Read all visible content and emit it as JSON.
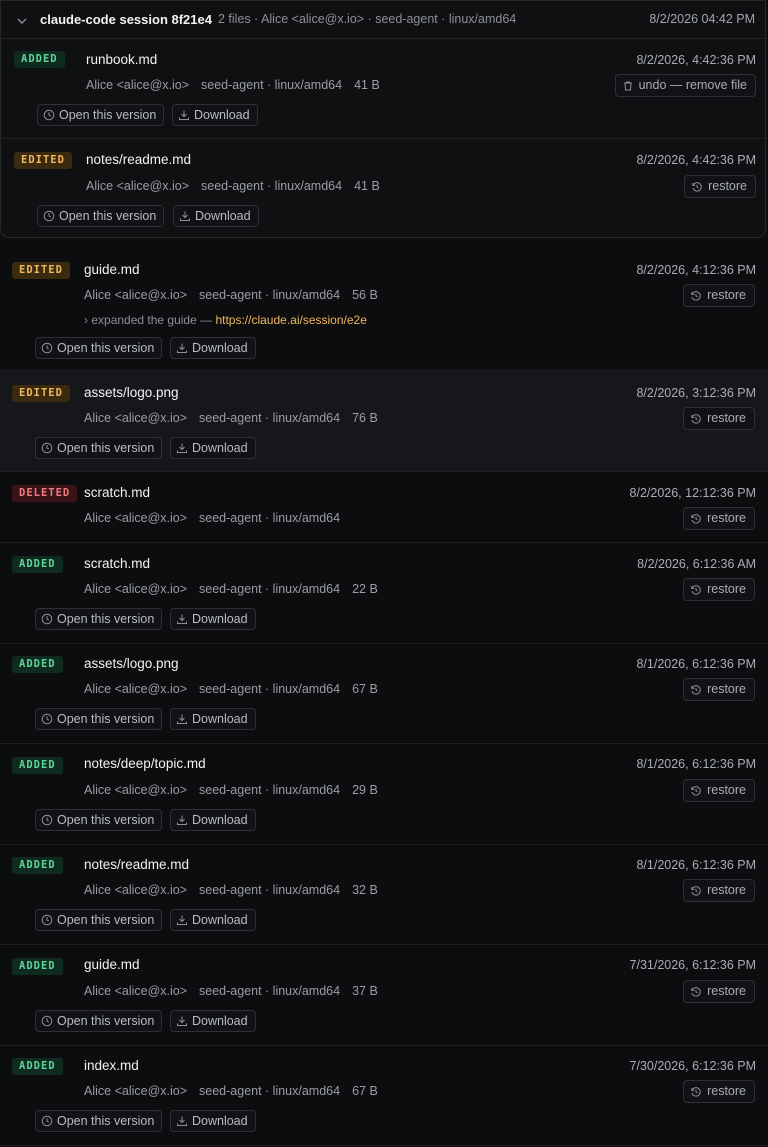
{
  "session": {
    "title": "claude-code session 8f21e4",
    "meta": "2 files · Alice <alice@x.io> · seed-agent · linux/amd64",
    "date": "8/2/2026 04:42 PM"
  },
  "labels": {
    "open": "Open this version",
    "download": "Download",
    "restore": "restore",
    "undo": "undo — remove file",
    "author": "Alice <alice@x.io>",
    "agent": "seed-agent · linux/amd64"
  },
  "rows": [
    {
      "badge": "ADDED",
      "file": "runbook.md",
      "date": "8/2/2026, 4:42:36 PM",
      "size": "41 B"
    },
    {
      "badge": "EDITED",
      "file": "notes/readme.md",
      "date": "8/2/2026, 4:42:36 PM",
      "size": "41 B"
    },
    {
      "badge": "EDITED",
      "file": "guide.md",
      "date": "8/2/2026, 4:12:36 PM",
      "size": "56 B",
      "note": "expanded the guide —",
      "link": "https://claude.ai/session/e2e"
    },
    {
      "badge": "EDITED",
      "file": "assets/logo.png",
      "date": "8/2/2026, 3:12:36 PM",
      "size": "76 B"
    },
    {
      "badge": "DELETED",
      "file": "scratch.md",
      "date": "8/2/2026, 12:12:36 PM",
      "size": ""
    },
    {
      "badge": "ADDED",
      "file": "scratch.md",
      "date": "8/2/2026, 6:12:36 AM",
      "size": "22 B"
    },
    {
      "badge": "ADDED",
      "file": "assets/logo.png",
      "date": "8/1/2026, 6:12:36 PM",
      "size": "67 B"
    },
    {
      "badge": "ADDED",
      "file": "notes/deep/topic.md",
      "date": "8/1/2026, 6:12:36 PM",
      "size": "29 B"
    },
    {
      "badge": "ADDED",
      "file": "notes/readme.md",
      "date": "8/1/2026, 6:12:36 PM",
      "size": "32 B"
    },
    {
      "badge": "ADDED",
      "file": "guide.md",
      "date": "7/31/2026, 6:12:36 PM",
      "size": "37 B"
    },
    {
      "badge": "ADDED",
      "file": "index.md",
      "date": "7/30/2026, 6:12:36 PM",
      "size": "67 B"
    }
  ]
}
